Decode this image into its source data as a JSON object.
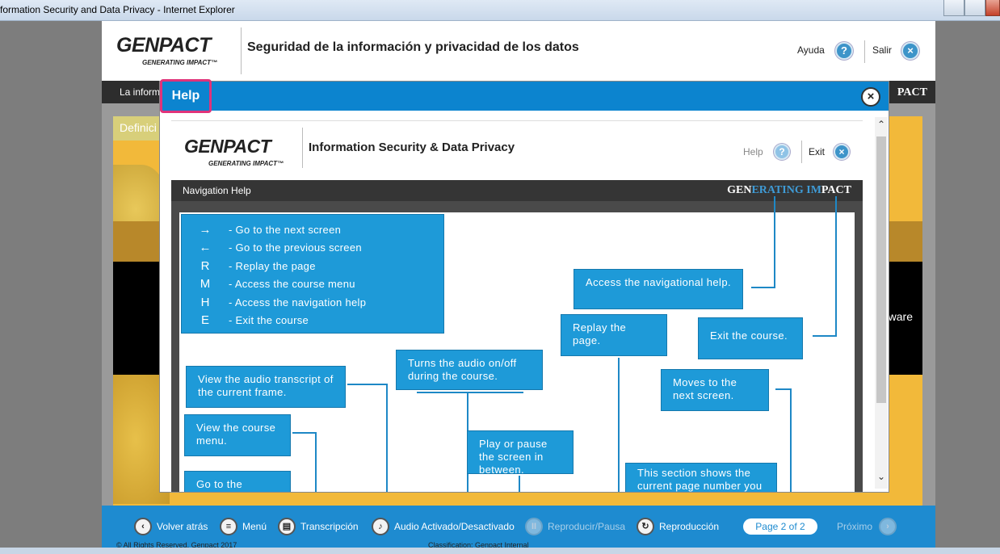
{
  "window": {
    "title": "formation Security and Data Privacy - Internet Explorer"
  },
  "shell": {
    "logo_word": "GENPACT",
    "logo_tag": "GENERATING IMPACT™",
    "title": "Seguridad de la información y privacidad de los datos",
    "help_label": "Ayuda",
    "exit_label": "Salir",
    "breadcrumb": "La inform",
    "brand_right": "PACT",
    "stage_tab": "Definici",
    "stage_text_right": "ware"
  },
  "toolbar": {
    "back": "Volver atrás",
    "menu": "Menú",
    "transcript": "Transcripción",
    "audio": "Audio Activado/Desactivado",
    "play_pause": "Reproducir/Pausa",
    "replay": "Reproducción",
    "page": "Page 2 of 2",
    "next": "Próximo",
    "copyright": "© All Rights Reserved. Genpact 2017",
    "classification": "Classification: Genpact Internal"
  },
  "modal": {
    "tab_label": "Help",
    "close_glyph": "×"
  },
  "doc": {
    "logo_word": "GENPACT",
    "logo_tag": "GENERATING IMPACT™",
    "title": "Information Security & Data Privacy",
    "help_label": "Help",
    "exit_label": "Exit",
    "bar_label": "Navigation Help",
    "brand_a": "GEN",
    "brand_b": "ERATING IM",
    "brand_c": "PACT"
  },
  "legend": [
    {
      "key": "→",
      "text": "- Go to the next screen"
    },
    {
      "key": "←",
      "text": "- Go to the previous screen"
    },
    {
      "key": "R",
      "text": "- Replay the page"
    },
    {
      "key": "M",
      "text": "- Access the course menu"
    },
    {
      "key": "H",
      "text": "- Access the navigation help"
    },
    {
      "key": "E",
      "text": "- Exit the course"
    }
  ],
  "callouts": {
    "nav_help": "Access the navigational help.",
    "replay": "Replay the page.",
    "exit": "Exit the course.",
    "audio": "Turns the audio on/off during the course.",
    "transcript": "View the audio transcript of the current frame.",
    "next": "Moves to the next screen.",
    "menu": "View the course menu.",
    "play": "Play or pause the screen in between.",
    "goto": "Go to the",
    "page_section": "This section shows the current page number you"
  },
  "colors": {
    "accent": "#0c84cf",
    "callout": "#1e9ad8",
    "highlight": "#e0337a",
    "stage": "#f2b93a"
  }
}
